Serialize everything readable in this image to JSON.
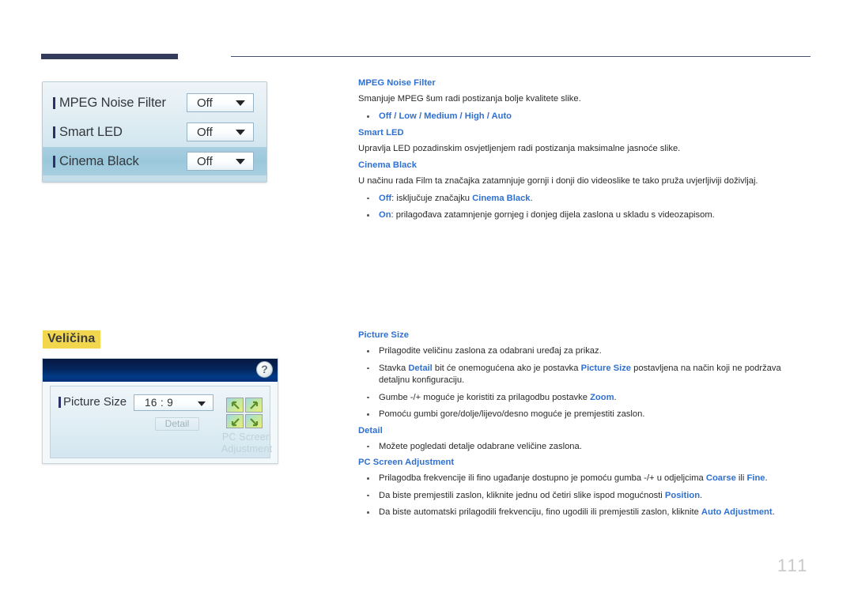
{
  "page": {
    "number": "111",
    "header_rule": true
  },
  "osd_mockup_1": {
    "rows": [
      {
        "label": "MPEG Noise Filter",
        "value": "Off",
        "highlighted": false
      },
      {
        "label": "Smart LED",
        "value": "Off",
        "highlighted": false
      },
      {
        "label": "Cinema Black",
        "value": "Off",
        "highlighted": true
      }
    ]
  },
  "size_section": {
    "heading": "Veličina",
    "heading_highlight_color": "#f2d74e"
  },
  "osd_mockup_2": {
    "help_icon": "?",
    "picture_size_label": "Picture Size",
    "picture_size_value": "16 : 9",
    "detail_button": "Detail",
    "pc_screen_adjustment_label": "PC Screen Adjustment"
  },
  "doc_top": {
    "sections": [
      {
        "title": "MPEG Noise Filter",
        "paragraph": "Smanjuje MPEG šum radi postizanja bolje kvalitete slike.",
        "bullet_options": "Off / Low / Medium / High / Auto"
      },
      {
        "title": "Smart LED",
        "paragraph": "Upravlja LED pozadinskim osvjetljenjem radi postizanja maksimalne jasnoće slike."
      },
      {
        "title": "Cinema Black",
        "paragraph": "U načinu rada Film ta značajka zatamnjuje gornji i donji dio videoslike te tako pruža uvjerljiviji doživljaj.",
        "bullets": [
          "Off: isključuje značajku Cinema Black.",
          "On: prilagođava zatamnjenje gornjeg i donjeg dijela zaslona u skladu s videozapisom."
        ]
      }
    ]
  },
  "doc_bottom": {
    "sections": [
      {
        "title": "Picture Size",
        "bullets": [
          "Prilagodite veličinu zaslona za odabrani uređaj za prikaz.",
          "Stavka Detail bit će onemogućena ako je postavka Picture Size postavljena na način koji ne podržava detaljnu konfiguraciju.",
          "Gumbe -/+ moguće je koristiti za prilagodbu postavke Zoom.",
          "Pomoću gumbi gore/dolje/lijevo/desno moguće je premjestiti zaslon."
        ]
      },
      {
        "title": "Detail",
        "bullets": [
          "Možete pogledati detalje odabrane veličine zaslona."
        ]
      },
      {
        "title": "PC Screen Adjustment",
        "bullets": [
          "Prilagodba frekvencije ili fino ugađanje dostupno je pomoću gumba -/+ u odjeljcima Coarse ili Fine.",
          "Da biste premjestili zaslon, kliknite jednu od četiri slike ispod mogućnosti Position.",
          "Da biste automatski prilagodili frekvenciju, fino ugodili ili premjestili zaslon, kliknite Auto Adjustment."
        ]
      }
    ]
  }
}
